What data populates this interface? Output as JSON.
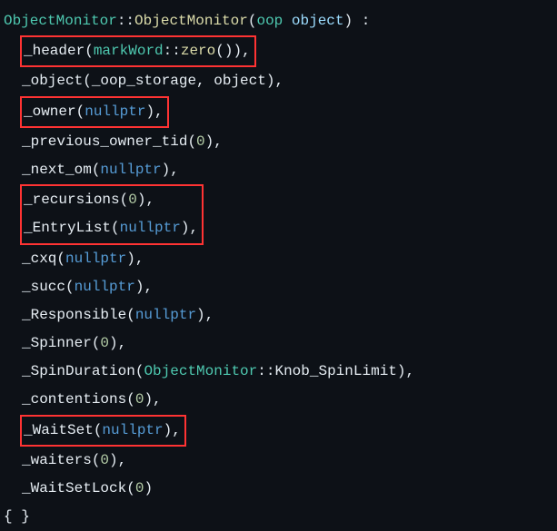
{
  "code": {
    "line1": {
      "class": "ObjectMonitor",
      "scope": "::",
      "ctor": "ObjectMonitor",
      "paren_open": "(",
      "ptype": "oop",
      "pspace": " ",
      "pname": "object",
      "paren_close": ")",
      " colon": " :"
    },
    "l_header": {
      "pre": "_header",
      "open": "(",
      "inner_class": "markWord",
      "scope": "::",
      "inner_func": "zero",
      "op": "(",
      "cp": ")",
      "close": ")",
      "comma": ","
    },
    "l_object": {
      "pre": "_object",
      "open": "(",
      "arg1": "_oop_storage",
      "comma_args": ", ",
      "arg2": "object",
      "close": ")",
      "comma": ","
    },
    "l_owner": {
      "pre": "_owner",
      "open": "(",
      "kw": "nullptr",
      "close": ")",
      "comma": ","
    },
    "l_prev": {
      "pre": "_previous_owner_tid",
      "open": "(",
      "num": "0",
      "close": ")",
      "comma": ","
    },
    "l_next": {
      "pre": "_next_om",
      "open": "(",
      "kw": "nullptr",
      "close": ")",
      "comma": ","
    },
    "l_rec": {
      "pre": "_recursions",
      "open": "(",
      "num": "0",
      "close": ")",
      "comma": ","
    },
    "l_entry": {
      "pre": "_EntryList",
      "open": "(",
      "kw": "nullptr",
      "close": ")",
      "comma": ","
    },
    "l_cxq": {
      "pre": "_cxq",
      "open": "(",
      "kw": "nullptr",
      "close": ")",
      "comma": ","
    },
    "l_succ": {
      "pre": "_succ",
      "open": "(",
      "kw": "nullptr",
      "close": ")",
      "comma": ","
    },
    "l_resp": {
      "pre": "_Responsible",
      "open": "(",
      "kw": "nullptr",
      "close": ")",
      "comma": ","
    },
    "l_spin": {
      "pre": "_Spinner",
      "open": "(",
      "num": "0",
      "close": ")",
      "comma": ","
    },
    "l_spindur": {
      "pre": "_SpinDuration",
      "open": "(",
      "cls": "ObjectMonitor",
      "scope": "::",
      "field": "Knob_SpinLimit",
      "close": ")",
      "comma": ","
    },
    "l_cont": {
      "pre": "_contentions",
      "open": "(",
      "num": "0",
      "close": ")",
      "comma": ","
    },
    "l_wait": {
      "pre": "_WaitSet",
      "open": "(",
      "kw": "nullptr",
      "close": ")",
      "comma": ","
    },
    "l_waiters": {
      "pre": "_waiters",
      "open": "(",
      "num": "0",
      "close": ")",
      "comma": ","
    },
    "l_wslock": {
      "pre": "_WaitSetLock",
      "open": "(",
      "num": "0",
      "close": ")"
    },
    "l_body": "{ }"
  }
}
